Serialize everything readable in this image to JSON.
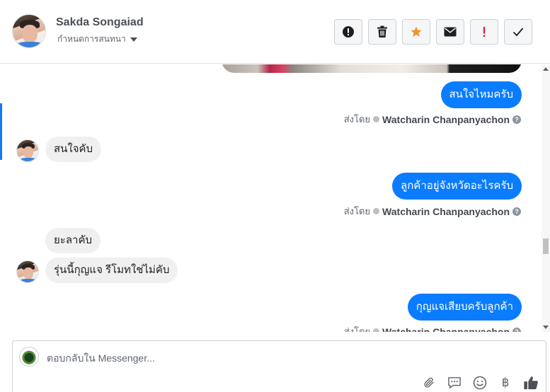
{
  "header": {
    "contact_name": "Sakda Songaiad",
    "conversation_setting": "กำหนดการสนทนา",
    "toolbar": [
      {
        "icon": "alert-icon",
        "label": "!"
      },
      {
        "icon": "trash-icon"
      },
      {
        "icon": "star-icon",
        "color": "#f0932b"
      },
      {
        "icon": "envelope-icon"
      },
      {
        "icon": "exclamation-icon",
        "label": "!",
        "color": "#e41e3f"
      },
      {
        "icon": "check-icon"
      }
    ]
  },
  "messages": [
    {
      "direction": "out",
      "text": "สนใจไหมครับ"
    },
    {
      "direction": "meta",
      "prefix": "ส่งโดย",
      "sender": "Watcharin Chanpanyachon",
      "help": "?"
    },
    {
      "direction": "in",
      "text": "สนใจคับ"
    },
    {
      "direction": "out",
      "text": "ลูกค้าอยู่จังหวัดอะไรครับ"
    },
    {
      "direction": "meta",
      "prefix": "ส่งโดย",
      "sender": "Watcharin Chanpanyachon",
      "help": "?"
    },
    {
      "direction": "in",
      "text": "ยะลาคับ"
    },
    {
      "direction": "in",
      "text": "รุ่นนี้กุญแจ รีโมทใช่ไม่คับ"
    },
    {
      "direction": "out",
      "text": "กุญแจเสียบครับลูกค้า"
    },
    {
      "direction": "meta",
      "prefix": "ส่งโดย",
      "sender": "Watcharin Chanpanyachon",
      "help": "?"
    }
  ],
  "composer": {
    "placeholder": "ตอบกลับใน Messenger...",
    "tools": [
      "paperclip-icon",
      "speech-bubble-icon",
      "smiley-icon",
      "baht-icon",
      "thumbs-up-icon"
    ],
    "baht_symbol": "฿"
  },
  "colors": {
    "accent": "#0a7cff",
    "incoming_bubble": "#f0f0f0",
    "star": "#f0932b",
    "exclamation": "#e41e3f"
  }
}
